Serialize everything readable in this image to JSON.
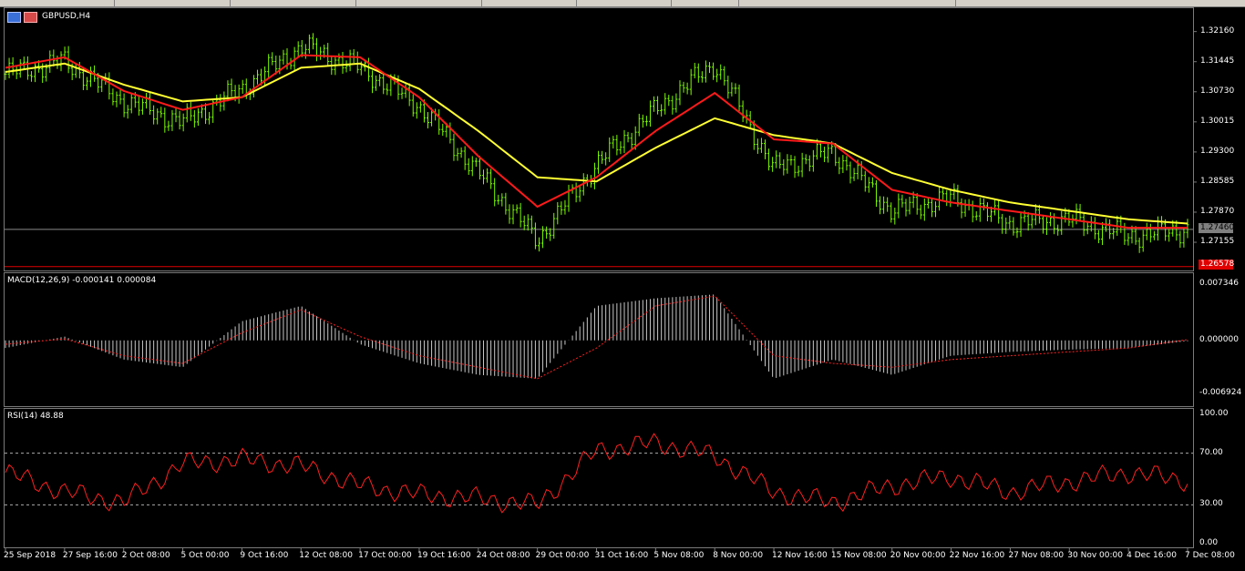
{
  "window": {
    "symbol_title": "GBPUSD,H4"
  },
  "panes": {
    "price": {
      "price_ticks": [
        "1.32160",
        "1.31445",
        "1.30730",
        "1.30015",
        "1.29300",
        "1.28585",
        "1.27870",
        "1.27155"
      ],
      "current_price": "1.27460",
      "red_level": "1.26578"
    },
    "macd": {
      "title": "MACD(12,26,9) -0.000141 0.000084",
      "ticks": [
        "0.007346",
        "0.000000",
        "-0.006924"
      ]
    },
    "rsi": {
      "title": "RSI(14) 48.88",
      "ticks": [
        "100.00",
        "70.00",
        "30.00",
        "0.00"
      ]
    }
  },
  "time_axis": [
    "25 Sep 2018",
    "27 Sep 16:00",
    "2 Oct 08:00",
    "5 Oct 00:00",
    "9 Oct 16:00",
    "12 Oct 08:00",
    "17 Oct 00:00",
    "19 Oct 16:00",
    "24 Oct 08:00",
    "29 Oct 00:00",
    "31 Oct 16:00",
    "5 Nov 08:00",
    "8 Nov 00:00",
    "12 Nov 16:00",
    "15 Nov 08:00",
    "20 Nov 00:00",
    "22 Nov 16:00",
    "27 Nov 08:00",
    "30 Nov 00:00",
    "4 Dec 16:00",
    "7 Dec 08:00"
  ],
  "colors": {
    "background": "#000000",
    "candle": "#7cfc00",
    "ma_fast": "#ff1a1a",
    "ma_slow": "#ffff33",
    "macd_hist": "#c8c8c8",
    "macd_signal": "#ff2020",
    "rsi_line": "#ff2020",
    "grid": "#7a7a7a",
    "price_tag_bg": "#808080",
    "red_tag_bg": "#e00000"
  },
  "chart_data": [
    {
      "type": "line",
      "title": "GBPUSD,H4",
      "ylim": [
        1.2655,
        1.3265
      ],
      "x": [
        "25 Sep 2018",
        "27 Sep 16:00",
        "2 Oct 08:00",
        "5 Oct 00:00",
        "9 Oct 16:00",
        "12 Oct 08:00",
        "17 Oct 00:00",
        "19 Oct 16:00",
        "24 Oct 08:00",
        "29 Oct 00:00",
        "31 Oct 16:00",
        "5 Nov 08:00",
        "8 Nov 00:00",
        "12 Nov 16:00",
        "15 Nov 08:00",
        "20 Nov 00:00",
        "22 Nov 16:00",
        "27 Nov 08:00",
        "30 Nov 00:00",
        "4 Dec 16:00",
        "7 Dec 08:00"
      ],
      "series": [
        {
          "values": [
            1.3115,
            1.3145,
            1.305,
            1.3,
            1.308,
            1.318,
            1.313,
            1.304,
            1.288,
            1.272,
            1.29,
            1.303,
            1.314,
            1.289,
            1.293,
            1.279,
            1.282,
            1.276,
            1.277,
            1.273,
            1.2746
          ]
        },
        {
          "values": [
            1.313,
            1.3155,
            1.3075,
            1.303,
            1.306,
            1.316,
            1.3155,
            1.306,
            1.292,
            1.28,
            1.287,
            1.298,
            1.307,
            1.296,
            1.295,
            1.284,
            1.281,
            1.279,
            1.277,
            1.275,
            1.275
          ]
        },
        {
          "values": [
            1.312,
            1.314,
            1.309,
            1.305,
            1.306,
            1.313,
            1.314,
            1.308,
            1.298,
            1.287,
            1.286,
            1.294,
            1.301,
            1.297,
            1.295,
            1.288,
            1.284,
            1.281,
            1.279,
            1.277,
            1.276
          ]
        }
      ]
    },
    {
      "type": "bar",
      "title": "MACD(12,26,9) -0.000141 0.000084",
      "ylim": [
        -0.006924,
        0.007346
      ],
      "x": [
        "25 Sep 2018",
        "27 Sep 16:00",
        "2 Oct 08:00",
        "5 Oct 00:00",
        "9 Oct 16:00",
        "12 Oct 08:00",
        "17 Oct 00:00",
        "19 Oct 16:00",
        "24 Oct 08:00",
        "29 Oct 00:00",
        "31 Oct 16:00",
        "5 Nov 08:00",
        "8 Nov 00:00",
        "12 Nov 16:00",
        "15 Nov 08:00",
        "20 Nov 00:00",
        "22 Nov 16:00",
        "27 Nov 08:00",
        "30 Nov 00:00",
        "4 Dec 16:00",
        "7 Dec 08:00"
      ],
      "series": [
        {
          "values": [
            -0.001,
            0.0005,
            -0.0025,
            -0.0035,
            0.0025,
            0.0045,
            -0.0005,
            -0.003,
            -0.0045,
            -0.005,
            0.0045,
            0.0055,
            0.006,
            -0.005,
            -0.0025,
            -0.0045,
            -0.002,
            -0.0015,
            -0.0012,
            -0.001,
            -0.0001
          ]
        },
        {
          "values": [
            -0.0005,
            0.0002,
            -0.002,
            -0.003,
            0.001,
            0.004,
            0.0005,
            -0.002,
            -0.0035,
            -0.005,
            -0.001,
            0.0045,
            0.0058,
            -0.002,
            -0.003,
            -0.0035,
            -0.0025,
            -0.002,
            -0.0015,
            -0.001,
            0.0001
          ]
        }
      ]
    },
    {
      "type": "line",
      "title": "RSI(14) 48.88",
      "ylim": [
        0,
        100
      ],
      "x": [
        "25 Sep 2018",
        "27 Sep 16:00",
        "2 Oct 08:00",
        "5 Oct 00:00",
        "9 Oct 16:00",
        "12 Oct 08:00",
        "17 Oct 00:00",
        "19 Oct 16:00",
        "24 Oct 08:00",
        "29 Oct 00:00",
        "31 Oct 16:00",
        "5 Nov 08:00",
        "8 Nov 00:00",
        "12 Nov 16:00",
        "15 Nov 08:00",
        "20 Nov 00:00",
        "22 Nov 16:00",
        "27 Nov 08:00",
        "30 Nov 00:00",
        "4 Dec 16:00",
        "7 Dec 08:00"
      ],
      "series": [
        {
          "values": [
            55,
            40,
            32,
            62,
            65,
            60,
            45,
            38,
            35,
            30,
            72,
            78,
            68,
            40,
            32,
            45,
            52,
            40,
            48,
            55,
            48.88
          ]
        }
      ]
    }
  ]
}
